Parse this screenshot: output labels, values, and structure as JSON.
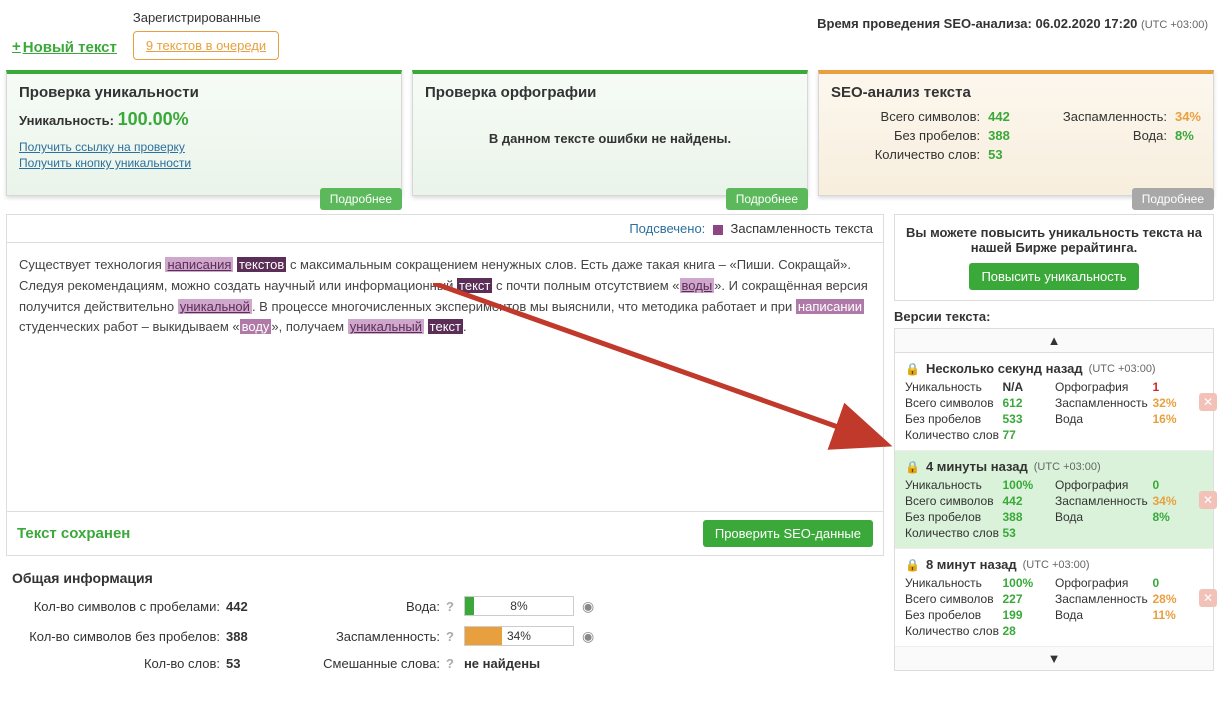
{
  "header": {
    "new_text": "Новый текст",
    "registered": "Зарегистрированные",
    "queue": "9 текстов в очереди",
    "seo_time_label": "Время проведения SEO-анализа:",
    "seo_time_value": "06.02.2020 17:20",
    "tz": "(UTC +03:00)"
  },
  "panels": {
    "uniq": {
      "title": "Проверка уникальности",
      "label": "Уникальность:",
      "value": "100.00%",
      "link1": "Получить ссылку на проверку",
      "link2": "Получить кнопку уникальности",
      "more": "Подробнее"
    },
    "spell": {
      "title": "Проверка орфографии",
      "ok": "В данном тексте ошибки не найдены.",
      "more": "Подробнее"
    },
    "seo": {
      "title": "SEO-анализ текста",
      "all_chars_l": "Всего символов:",
      "all_chars_v": "442",
      "no_spaces_l": "Без пробелов:",
      "no_spaces_v": "388",
      "words_l": "Количество слов:",
      "words_v": "53",
      "spam_l": "Заспамленность:",
      "spam_v": "34%",
      "water_l": "Вода:",
      "water_v": "8%",
      "more": "Подробнее"
    }
  },
  "highlight": {
    "prefix": "Подсвечено:",
    "label": "Заспамленность текста"
  },
  "text": {
    "p1a": "Существует технология ",
    "h1": "написания",
    "h2": "текстов",
    "p1b": " с максимальным сокращением ненужных слов. Есть даже такая книга – «Пиши. Сокращай». Следуя рекомендациям, можно создать научный или информационный ",
    "h3": "текст",
    "p1c": " с почти полным отсутствием «",
    "h4": "воды",
    "p1d": "». И сокращённая версия получится действительно ",
    "h5": "уникальной",
    "p1e": ". В процессе многочисленных экспериментов мы выяснили, что методика работает и при ",
    "h6": "написании",
    "p1f": " студенческих работ – выкидываем «",
    "h7": "воду",
    "p1g": "», получаем ",
    "h8": "уникальный",
    "h9": "текст",
    "p1h": "."
  },
  "savebar": {
    "saved": "Текст сохранен",
    "check": "Проверить SEO-данные"
  },
  "info": {
    "title": "Общая информация",
    "chars_sp_l": "Кол-во символов с пробелами:",
    "chars_sp_v": "442",
    "chars_ns_l": "Кол-во символов без пробелов:",
    "chars_ns_v": "388",
    "words_l": "Кол-во слов:",
    "words_v": "53",
    "water_l": "Вода:",
    "water_v": "8%",
    "spam_l": "Заспамленность:",
    "spam_v": "34%",
    "mixed_l": "Смешанные слова:",
    "mixed_v": "не найдены"
  },
  "promo": {
    "text": "Вы можете повысить уникальность текста на нашей Бирже рерайтинга.",
    "btn": "Повысить уникальность"
  },
  "versions": {
    "title": "Версии текста:",
    "items": [
      {
        "ago": "Несколько секунд назад",
        "tz": "(UTC +03:00)",
        "uniq_l": "Уникальность",
        "uniq_v": "N/A",
        "uniq_c": "",
        "spell_l": "Орфография",
        "spell_v": "1",
        "spell_c": "vr",
        "chars_l": "Всего символов",
        "chars_v": "612",
        "spam_l": "Заспамленность",
        "spam_v": "32%",
        "nosp_l": "Без пробелов",
        "nosp_v": "533",
        "water_l": "Вода",
        "water_v": "16%",
        "words_l": "Количество слов",
        "words_v": "77"
      },
      {
        "ago": "4 минуты назад",
        "tz": "(UTC +03:00)",
        "uniq_l": "Уникальность",
        "uniq_v": "100%",
        "spell_l": "Орфография",
        "spell_v": "0",
        "chars_l": "Всего символов",
        "chars_v": "442",
        "spam_l": "Заспамленность",
        "spam_v": "34%",
        "nosp_l": "Без пробелов",
        "nosp_v": "388",
        "water_l": "Вода",
        "water_v": "8%",
        "words_l": "Количество слов",
        "words_v": "53"
      },
      {
        "ago": "8 минут назад",
        "tz": "(UTC +03:00)",
        "uniq_l": "Уникальность",
        "uniq_v": "100%",
        "spell_l": "Орфография",
        "spell_v": "0",
        "chars_l": "Всего символов",
        "chars_v": "227",
        "spam_l": "Заспамленность",
        "spam_v": "28%",
        "nosp_l": "Без пробелов",
        "nosp_v": "199",
        "water_l": "Вода",
        "water_v": "11%",
        "words_l": "Количество слов",
        "words_v": "28"
      }
    ]
  }
}
